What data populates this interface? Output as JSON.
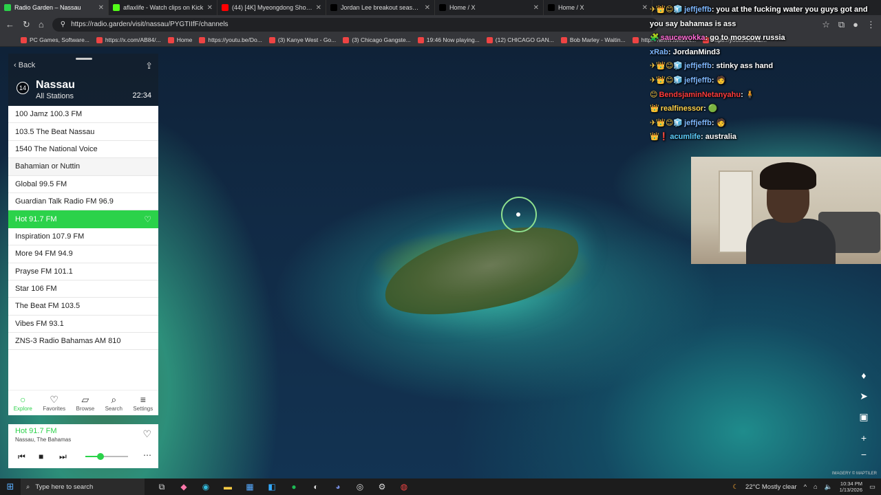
{
  "browser": {
    "tabs": [
      {
        "title": "Radio Garden – Nassau",
        "color": "#2bd24a",
        "active": true
      },
      {
        "title": "aflaxlife - Watch clips on Kick",
        "color": "#53fc18"
      },
      {
        "title": "(44) [4K] Myeongdong Shopping",
        "color": "#ff0000"
      },
      {
        "title": "Jordan Lee breakout season on X",
        "color": "#000000"
      },
      {
        "title": "Home / X",
        "color": "#000000"
      },
      {
        "title": "Home / X",
        "color": "#000000"
      }
    ],
    "url": "https://radio.garden/visit/nassau/PYGTIIfF/channels",
    "bookmarks": [
      "PC Games, Software...",
      "https://x.com/AB84/...",
      "Home",
      "https://youtu.be/Do...",
      "(3) Kanye West - Go...",
      "(3) Chicago Gangste...",
      "19:46 Now playing...",
      "(12) CHICAGO GAN...",
      "Bob Marley - Waitin...",
      "https://www.twitch.t...",
      "https://youtu.be/bIZ..."
    ]
  },
  "chat": [
    {
      "badges": "✈👑😊🧊",
      "user": "jeffjeffb",
      "msg": "you at the fucking water you guys got and"
    },
    {
      "badges": "",
      "user": "",
      "msg": "you say bahamas is ass"
    },
    {
      "badges": "🧩",
      "user": "saucewokka",
      "msg": "go to moscow russia"
    },
    {
      "badges": "",
      "user": "xRab",
      "msg": "JordanMind3"
    },
    {
      "badges": "✈👑😊🧊",
      "user": "jeffjeffb",
      "msg": "stinky ass hand"
    },
    {
      "badges": "✈👑😊🧊",
      "user": "jeffjeffb",
      "msg": "🧑"
    },
    {
      "badges": "😊",
      "user": "BendsjaminNetanyahu",
      "msg": "🧍"
    },
    {
      "badges": "👑",
      "user": "realfinessor",
      "msg": "🟢"
    },
    {
      "badges": "✈👑😊🧊",
      "user": "jeffjeffb",
      "msg": "🧑"
    },
    {
      "badges": "👑❗",
      "user": "acumlife",
      "msg": "australia"
    }
  ],
  "radio": {
    "back_label": "Back",
    "station_count": "14",
    "city": "Nassau",
    "subtitle": "All Stations",
    "time": "22:34",
    "stations": [
      "100 Jamz 100.3 FM",
      "103.5 The Beat Nassau",
      "1540 The National Voice",
      "Bahamian or Nuttin",
      "Global 99.5 FM",
      "Guardian Talk Radio FM 96.9",
      "Hot 91.7 FM",
      "Inspiration 107.9 FM",
      "More 94 FM 94.9",
      "Prayse FM 101.1",
      "Star 106 FM",
      "The Beat FM 103.5",
      "Vibes FM 93.1",
      "ZNS-3 Radio Bahamas AM 810"
    ],
    "active_index": 6,
    "hover_index": 3,
    "nav": [
      {
        "label": "Explore",
        "icon": "○",
        "active": true
      },
      {
        "label": "Favorites",
        "icon": "♡"
      },
      {
        "label": "Browse",
        "icon": "▱"
      },
      {
        "label": "Search",
        "icon": "⌕"
      },
      {
        "label": "Settings",
        "icon": "≡"
      }
    ],
    "player": {
      "station": "Hot 91.7 FM",
      "location": "Nassau, The Bahamas",
      "volume": 0.35
    }
  },
  "map": {
    "attribution": "IMAGERY © MAPTILER"
  },
  "taskbar": {
    "search_placeholder": "Type here to search",
    "weather": "22°C  Mostly clear",
    "time": "10:34 PM",
    "date": "1/13/2026"
  }
}
